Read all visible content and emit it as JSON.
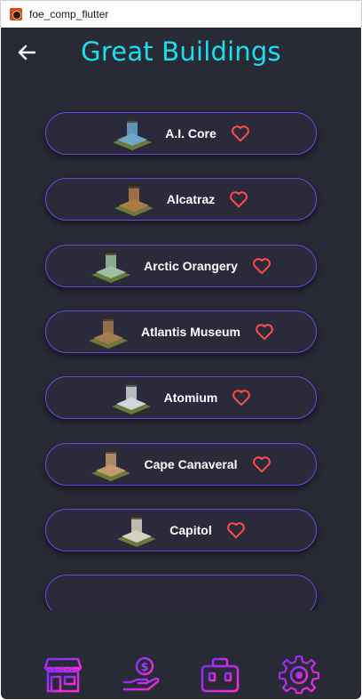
{
  "window": {
    "title": "foe_comp_flutter"
  },
  "header": {
    "title": "Great Buildings",
    "back_icon": "arrow-left-icon"
  },
  "buildings": [
    {
      "name": "A.I. Core",
      "thumb_color": "#6aa9c9"
    },
    {
      "name": "Alcatraz",
      "thumb_color": "#b07a45"
    },
    {
      "name": "Arctic Orangery",
      "thumb_color": "#9fc0a0"
    },
    {
      "name": "Atlantis Museum",
      "thumb_color": "#a47b4f"
    },
    {
      "name": "Atomium",
      "thumb_color": "#cfd6dc"
    },
    {
      "name": "Cape Canaveral",
      "thumb_color": "#c49a6c"
    },
    {
      "name": "Capitol",
      "thumb_color": "#d7d2bf"
    }
  ],
  "nav": [
    {
      "icon": "store-icon"
    },
    {
      "icon": "coin-hand-icon"
    },
    {
      "icon": "toolbox-icon"
    },
    {
      "icon": "gear-icon"
    }
  ],
  "colors": {
    "background": "#282a36",
    "accent_title": "#16e0f0",
    "card_border": "#6f45e8",
    "heart": "#ff4b4b",
    "nav_gradient_start": "#7b2ff7",
    "nav_gradient_end": "#ff2bd6"
  }
}
